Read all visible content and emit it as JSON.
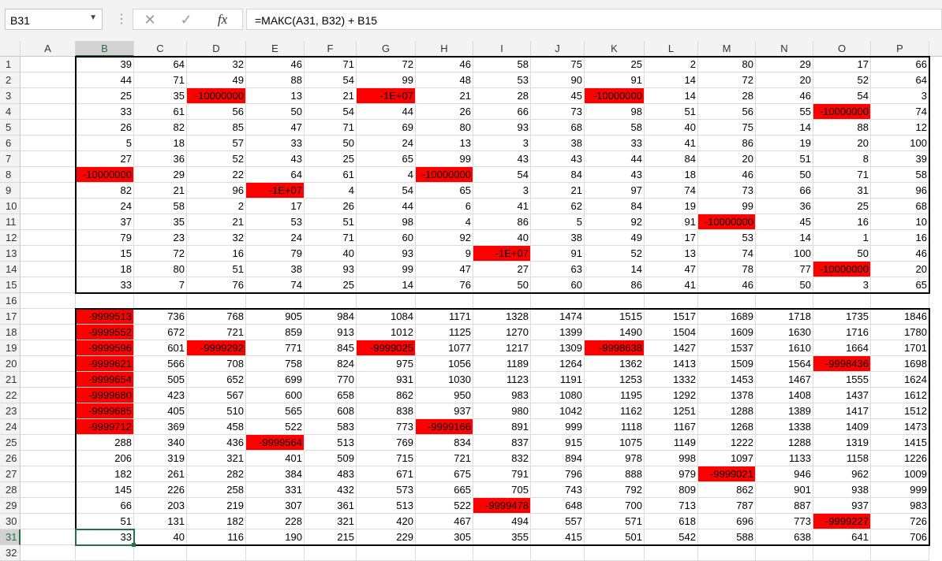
{
  "name_box": {
    "value": "B31",
    "arrow_icon": "dropdown-arrow-icon"
  },
  "formula_bar": {
    "cancel_icon": "✕",
    "enter_icon": "✓",
    "fx_label": "fx",
    "formula": "=МАКС(A31, B32) + B15"
  },
  "columns": [
    "A",
    "B",
    "C",
    "D",
    "E",
    "F",
    "G",
    "H",
    "I",
    "J",
    "K",
    "L",
    "M",
    "N",
    "O",
    "P"
  ],
  "selected_column": "B",
  "selected_row": 31,
  "highlight_color": "#ff0000",
  "rows": [
    {
      "n": "1",
      "b": "39",
      "c": "64",
      "d": "32",
      "e": "46",
      "f": "71",
      "g": "72",
      "h": "46",
      "i": "58",
      "j": "75",
      "k": "25",
      "l": "2",
      "m": "80",
      "nn": "29",
      "o": "17",
      "p": "66"
    },
    {
      "n": "2",
      "b": "44",
      "c": "71",
      "d": "49",
      "e": "88",
      "f": "54",
      "g": "99",
      "h": "48",
      "i": "53",
      "j": "90",
      "k": "91",
      "l": "14",
      "m": "72",
      "nn": "20",
      "o": "52",
      "p": "64"
    },
    {
      "n": "3",
      "b": "25",
      "c": "35",
      "d": "-10000000",
      "e": "13",
      "f": "21",
      "g": "-1E+07",
      "h": "21",
      "i": "28",
      "j": "45",
      "k": "-10000000",
      "l": "14",
      "m": "28",
      "nn": "46",
      "o": "54",
      "p": "3"
    },
    {
      "n": "4",
      "b": "33",
      "c": "61",
      "d": "56",
      "e": "50",
      "f": "54",
      "g": "44",
      "h": "26",
      "i": "66",
      "j": "73",
      "k": "98",
      "l": "51",
      "m": "56",
      "nn": "55",
      "o": "-10000000",
      "p": "74"
    },
    {
      "n": "5",
      "b": "26",
      "c": "82",
      "d": "85",
      "e": "47",
      "f": "71",
      "g": "69",
      "h": "80",
      "i": "93",
      "j": "68",
      "k": "58",
      "l": "40",
      "m": "75",
      "nn": "14",
      "o": "88",
      "p": "12"
    },
    {
      "n": "6",
      "b": "5",
      "c": "18",
      "d": "57",
      "e": "33",
      "f": "50",
      "g": "24",
      "h": "13",
      "i": "3",
      "j": "38",
      "k": "33",
      "l": "41",
      "m": "86",
      "nn": "19",
      "o": "20",
      "p": "100"
    },
    {
      "n": "7",
      "b": "27",
      "c": "36",
      "d": "52",
      "e": "43",
      "f": "25",
      "g": "65",
      "h": "99",
      "i": "43",
      "j": "43",
      "k": "44",
      "l": "84",
      "m": "20",
      "nn": "51",
      "o": "8",
      "p": "39"
    },
    {
      "n": "8",
      "b": "-10000000",
      "c": "29",
      "d": "22",
      "e": "64",
      "f": "61",
      "g": "4",
      "h": "-10000000",
      "i": "54",
      "j": "84",
      "k": "43",
      "l": "18",
      "m": "46",
      "nn": "50",
      "o": "71",
      "p": "58"
    },
    {
      "n": "9",
      "b": "82",
      "c": "21",
      "d": "96",
      "e": "-1E+07",
      "f": "4",
      "g": "54",
      "h": "65",
      "i": "3",
      "j": "21",
      "k": "97",
      "l": "74",
      "m": "73",
      "nn": "66",
      "o": "31",
      "p": "96"
    },
    {
      "n": "10",
      "b": "24",
      "c": "58",
      "d": "2",
      "e": "17",
      "f": "26",
      "g": "44",
      "h": "6",
      "i": "41",
      "j": "62",
      "k": "84",
      "l": "19",
      "m": "99",
      "nn": "36",
      "o": "25",
      "p": "68"
    },
    {
      "n": "11",
      "b": "37",
      "c": "35",
      "d": "21",
      "e": "53",
      "f": "51",
      "g": "98",
      "h": "4",
      "i": "86",
      "j": "5",
      "k": "92",
      "l": "91",
      "m": "-10000000",
      "nn": "45",
      "o": "16",
      "p": "10"
    },
    {
      "n": "12",
      "b": "79",
      "c": "23",
      "d": "32",
      "e": "24",
      "f": "71",
      "g": "60",
      "h": "92",
      "i": "40",
      "j": "38",
      "k": "49",
      "l": "17",
      "m": "53",
      "nn": "14",
      "o": "1",
      "p": "16"
    },
    {
      "n": "13",
      "b": "15",
      "c": "72",
      "d": "16",
      "e": "79",
      "f": "40",
      "g": "93",
      "h": "9",
      "i": "-1E+07",
      "j": "91",
      "k": "52",
      "l": "13",
      "m": "74",
      "nn": "100",
      "o": "50",
      "p": "46"
    },
    {
      "n": "14",
      "b": "18",
      "c": "80",
      "d": "51",
      "e": "38",
      "f": "93",
      "g": "99",
      "h": "47",
      "i": "27",
      "j": "63",
      "k": "14",
      "l": "47",
      "m": "78",
      "nn": "77",
      "o": "-10000000",
      "p": "20"
    },
    {
      "n": "15",
      "b": "33",
      "c": "7",
      "d": "76",
      "e": "74",
      "f": "25",
      "g": "14",
      "h": "76",
      "i": "50",
      "j": "60",
      "k": "86",
      "l": "41",
      "m": "46",
      "nn": "50",
      "o": "3",
      "p": "65"
    },
    {
      "n": "16",
      "b": "",
      "c": "",
      "d": "",
      "e": "",
      "f": "",
      "g": "",
      "h": "",
      "i": "",
      "j": "",
      "k": "",
      "l": "",
      "m": "",
      "nn": "",
      "o": "",
      "p": ""
    },
    {
      "n": "17",
      "b": "-9999513",
      "c": "736",
      "d": "768",
      "e": "905",
      "f": "984",
      "g": "1084",
      "h": "1171",
      "i": "1328",
      "j": "1474",
      "k": "1515",
      "l": "1517",
      "m": "1689",
      "nn": "1718",
      "o": "1735",
      "p": "1846"
    },
    {
      "n": "18",
      "b": "-9999552",
      "c": "672",
      "d": "721",
      "e": "859",
      "f": "913",
      "g": "1012",
      "h": "1125",
      "i": "1270",
      "j": "1399",
      "k": "1490",
      "l": "1504",
      "m": "1609",
      "nn": "1630",
      "o": "1716",
      "p": "1780"
    },
    {
      "n": "19",
      "b": "-9999596",
      "c": "601",
      "d": "-9999292",
      "e": "771",
      "f": "845",
      "g": "-9999025",
      "h": "1077",
      "i": "1217",
      "j": "1309",
      "k": "-9998638",
      "l": "1427",
      "m": "1537",
      "nn": "1610",
      "o": "1664",
      "p": "1701"
    },
    {
      "n": "20",
      "b": "-9999621",
      "c": "566",
      "d": "708",
      "e": "758",
      "f": "824",
      "g": "975",
      "h": "1056",
      "i": "1189",
      "j": "1264",
      "k": "1362",
      "l": "1413",
      "m": "1509",
      "nn": "1564",
      "o": "-9998436",
      "p": "1698"
    },
    {
      "n": "21",
      "b": "-9999654",
      "c": "505",
      "d": "652",
      "e": "699",
      "f": "770",
      "g": "931",
      "h": "1030",
      "i": "1123",
      "j": "1191",
      "k": "1253",
      "l": "1332",
      "m": "1453",
      "nn": "1467",
      "o": "1555",
      "p": "1624"
    },
    {
      "n": "22",
      "b": "-9999680",
      "c": "423",
      "d": "567",
      "e": "600",
      "f": "658",
      "g": "862",
      "h": "950",
      "i": "983",
      "j": "1080",
      "k": "1195",
      "l": "1292",
      "m": "1378",
      "nn": "1408",
      "o": "1437",
      "p": "1612"
    },
    {
      "n": "23",
      "b": "-9999685",
      "c": "405",
      "d": "510",
      "e": "565",
      "f": "608",
      "g": "838",
      "h": "937",
      "i": "980",
      "j": "1042",
      "k": "1162",
      "l": "1251",
      "m": "1288",
      "nn": "1389",
      "o": "1417",
      "p": "1512"
    },
    {
      "n": "24",
      "b": "-9999712",
      "c": "369",
      "d": "458",
      "e": "522",
      "f": "583",
      "g": "773",
      "h": "-9999166",
      "i": "891",
      "j": "999",
      "k": "1118",
      "l": "1167",
      "m": "1268",
      "nn": "1338",
      "o": "1409",
      "p": "1473"
    },
    {
      "n": "25",
      "b": "288",
      "c": "340",
      "d": "436",
      "e": "-9999564",
      "f": "513",
      "g": "769",
      "h": "834",
      "i": "837",
      "j": "915",
      "k": "1075",
      "l": "1149",
      "m": "1222",
      "nn": "1288",
      "o": "1319",
      "p": "1415"
    },
    {
      "n": "26",
      "b": "206",
      "c": "319",
      "d": "321",
      "e": "401",
      "f": "509",
      "g": "715",
      "h": "721",
      "i": "832",
      "j": "894",
      "k": "978",
      "l": "998",
      "m": "1097",
      "nn": "1133",
      "o": "1158",
      "p": "1226"
    },
    {
      "n": "27",
      "b": "182",
      "c": "261",
      "d": "282",
      "e": "384",
      "f": "483",
      "g": "671",
      "h": "675",
      "i": "791",
      "j": "796",
      "k": "888",
      "l": "979",
      "m": "-9999021",
      "nn": "946",
      "o": "962",
      "p": "1009"
    },
    {
      "n": "28",
      "b": "145",
      "c": "226",
      "d": "258",
      "e": "331",
      "f": "432",
      "g": "573",
      "h": "665",
      "i": "705",
      "j": "743",
      "k": "792",
      "l": "809",
      "m": "862",
      "nn": "901",
      "o": "938",
      "p": "999"
    },
    {
      "n": "29",
      "b": "66",
      "c": "203",
      "d": "219",
      "e": "307",
      "f": "361",
      "g": "513",
      "h": "522",
      "i": "-9999478",
      "j": "648",
      "k": "700",
      "l": "713",
      "m": "787",
      "nn": "887",
      "o": "937",
      "p": "983"
    },
    {
      "n": "30",
      "b": "51",
      "c": "131",
      "d": "182",
      "e": "228",
      "f": "321",
      "g": "420",
      "h": "467",
      "i": "494",
      "j": "557",
      "k": "571",
      "l": "618",
      "m": "696",
      "nn": "773",
      "o": "-9999227",
      "p": "726"
    },
    {
      "n": "31",
      "b": "33",
      "c": "40",
      "d": "116",
      "e": "190",
      "f": "215",
      "g": "229",
      "h": "305",
      "i": "355",
      "j": "415",
      "k": "501",
      "l": "542",
      "m": "588",
      "nn": "638",
      "o": "641",
      "p": "706"
    },
    {
      "n": "32",
      "b": "",
      "c": "",
      "d": "",
      "e": "",
      "f": "",
      "g": "",
      "h": "",
      "i": "",
      "j": "",
      "k": "",
      "l": "",
      "m": "",
      "nn": "",
      "o": "",
      "p": ""
    }
  ]
}
